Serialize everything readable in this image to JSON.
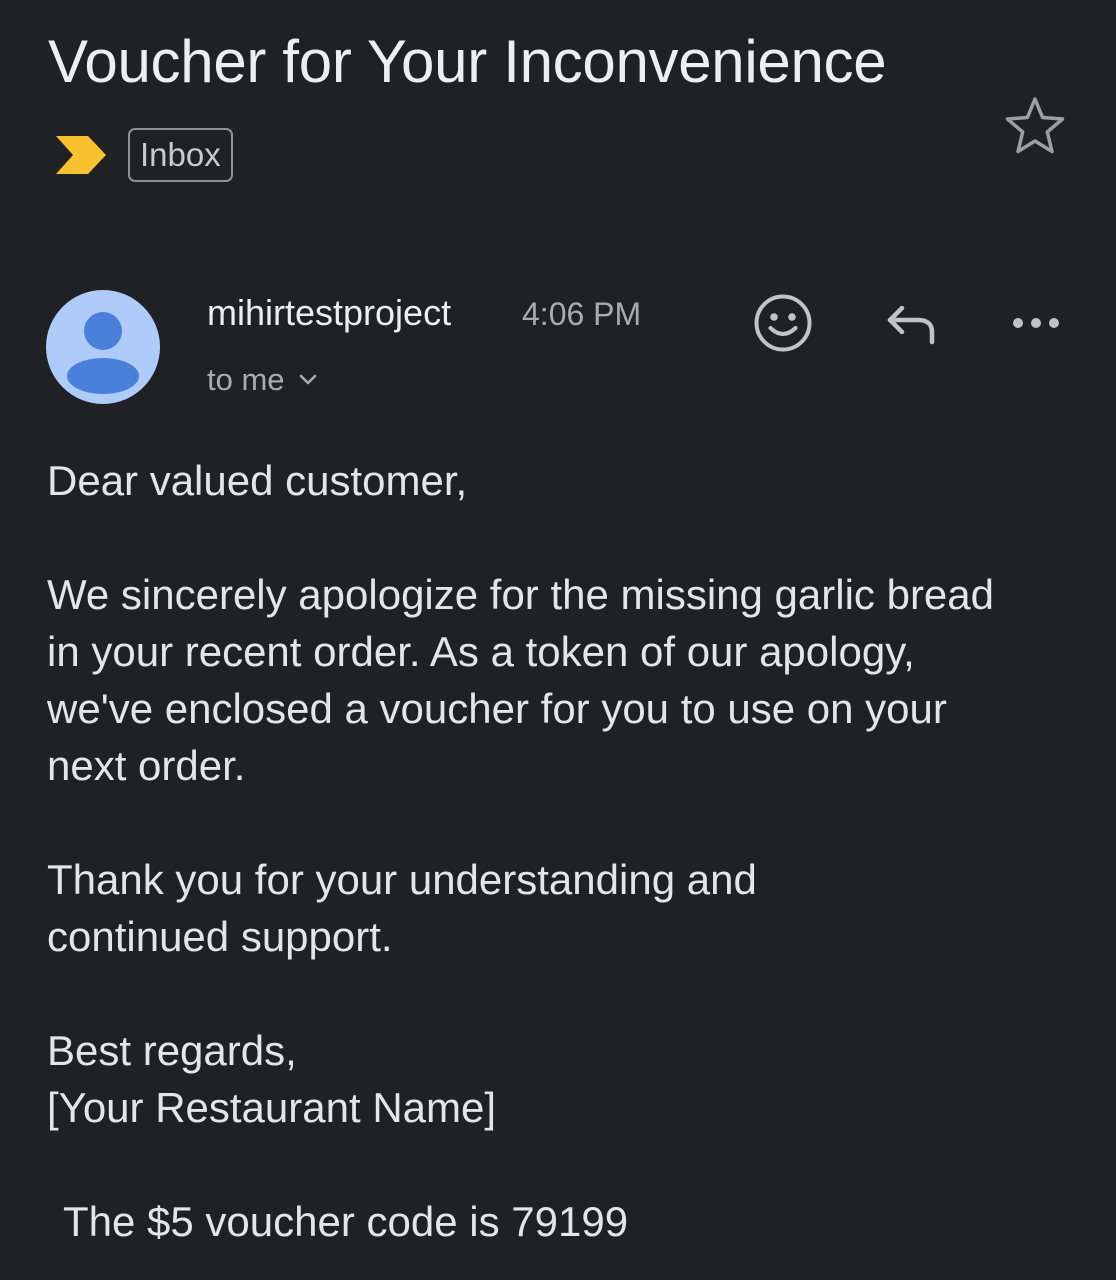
{
  "email": {
    "subject": "Voucher for Your Inconvenience",
    "label": "Inbox",
    "sender": "mihirtestproject",
    "time": "4:06 PM",
    "recipient": "to me",
    "body": {
      "greeting": "Dear valued customer,",
      "apology": "We sincerely apologize for the missing garlic bread in your recent order. As a token of our apology, we've enclosed a voucher for you to use on your next order.",
      "thanks": "Thank you for your understanding and continued support.",
      "sign_off": "Best regards,",
      "signature": "[Your Restaurant Name]",
      "voucher_line": "The $5 voucher code is 79199"
    }
  },
  "icons": {
    "importance": "importance-marker-icon",
    "star": "star-icon",
    "avatar": "person-icon",
    "expand": "chevron-down-icon",
    "emoji": "smiley-icon",
    "reply": "reply-icon",
    "more": "more-horizontal-icon"
  },
  "colors": {
    "background": "#202124",
    "importance_marker": "#f9c12e",
    "avatar_bg": "#aecbfa",
    "avatar_fg": "#4a80d9",
    "text_primary": "#e8eaed",
    "text_secondary": "#a8acb2"
  }
}
